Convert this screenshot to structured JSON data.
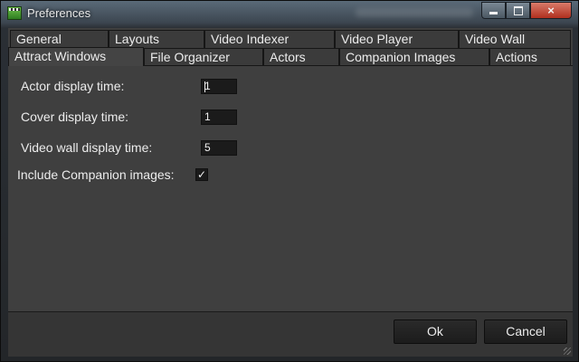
{
  "window": {
    "title": "Preferences",
    "icon": "clapperboard-icon",
    "controls": {
      "minimize": "minimize-icon",
      "maximize": "maximize-icon",
      "close": "×"
    }
  },
  "tabs": {
    "row1": [
      "General",
      "Layouts",
      "Video Indexer",
      "Video Player",
      "Video Wall"
    ],
    "row2": [
      "Attract Windows",
      "File Organizer",
      "Actors",
      "Companion Images",
      "Actions"
    ],
    "active": "Attract Windows"
  },
  "form": {
    "actor_display_time": {
      "label": "Actor display time:",
      "value": "1"
    },
    "cover_display_time": {
      "label": "Cover display time:",
      "value": "1"
    },
    "video_wall_display_time": {
      "label": "Video wall display time:",
      "value": "5"
    },
    "include_companion_images": {
      "label": "Include Companion images:",
      "checked": true,
      "mark": "✓"
    }
  },
  "buttons": {
    "ok": "Ok",
    "cancel": "Cancel"
  },
  "colors": {
    "background": "#3f3f3f",
    "input_bg": "#1b1b1b",
    "text": "#ececec",
    "close_red": "#b0301f"
  }
}
